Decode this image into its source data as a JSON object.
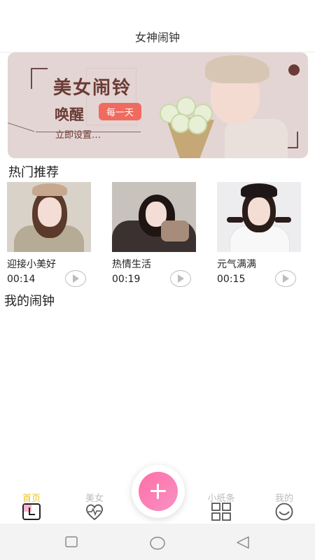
{
  "header": {
    "title": "女神闹钟"
  },
  "banner": {
    "heading": "美女闹铃",
    "subheading": "唤醒",
    "pill": "每一天",
    "cta": "立即设置…"
  },
  "sections": {
    "hot": "热门推荐",
    "mine": "我的闹钟"
  },
  "recommendations": [
    {
      "name": "迎接小美好",
      "duration": "00:14"
    },
    {
      "name": "热情生活",
      "duration": "00:19"
    },
    {
      "name": "元气满满",
      "duration": "00:15"
    }
  ],
  "tabs": [
    {
      "label": "首页",
      "icon": "home-clock-icon",
      "active": true
    },
    {
      "label": "美女",
      "icon": "heart-pulse-icon",
      "active": false
    },
    {
      "label": "小纸条",
      "icon": "grid-icon",
      "active": false
    },
    {
      "label": "我的",
      "icon": "smile-icon",
      "active": false
    }
  ],
  "colors": {
    "accent": "#f0c21e",
    "fab": "#ff6fa6",
    "banner_text": "#6b3b35",
    "pill": "#ef6b5f"
  }
}
